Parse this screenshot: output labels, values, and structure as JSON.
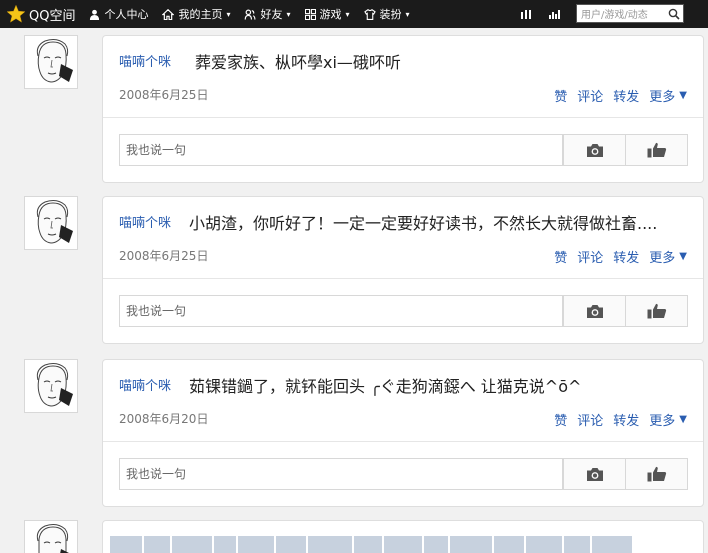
{
  "topbar": {
    "brand": "QQ空间",
    "nav": [
      {
        "label": "个人中心",
        "has_caret": false,
        "icon": "person-icon"
      },
      {
        "label": "我的主页",
        "has_caret": true,
        "icon": "home-icon"
      },
      {
        "label": "好友",
        "has_caret": true,
        "icon": "friends-icon"
      },
      {
        "label": "游戏",
        "has_caret": true,
        "icon": "grid-icon"
      },
      {
        "label": "装扮",
        "has_caret": true,
        "icon": "shirt-icon"
      }
    ],
    "search_placeholder": "用户/游戏/动态"
  },
  "posts": [
    {
      "author": "喵喃个咪",
      "content": "葬爱家族、枞吥學xi—硪吥听",
      "date": "2008年6月25日",
      "actions": {
        "like": "赞",
        "comment": "评论",
        "share": "转发",
        "more": "更多"
      },
      "comment_placeholder": "我也说一句"
    },
    {
      "author": "喵喃个咪",
      "content": "小胡渣，你听好了！一定一定要好好读书，不然长大就得做社畜....",
      "date": "2008年6月25日",
      "actions": {
        "like": "赞",
        "comment": "评论",
        "share": "转发",
        "more": "更多"
      },
      "comment_placeholder": "我也说一句"
    },
    {
      "author": "喵喃个咪",
      "content": "茹锞错鐹了，就钚能回头 ╭ぐ走狗滴鐚へ 让猫克说^ō^",
      "date": "2008年6月20日",
      "actions": {
        "like": "赞",
        "comment": "评论",
        "share": "转发",
        "more": "更多"
      },
      "comment_placeholder": "我也说一句"
    }
  ],
  "colors": {
    "topbar_bg": "#1b1b1b",
    "link_blue": "#2a5db0",
    "star_yellow": "#f5c518"
  }
}
